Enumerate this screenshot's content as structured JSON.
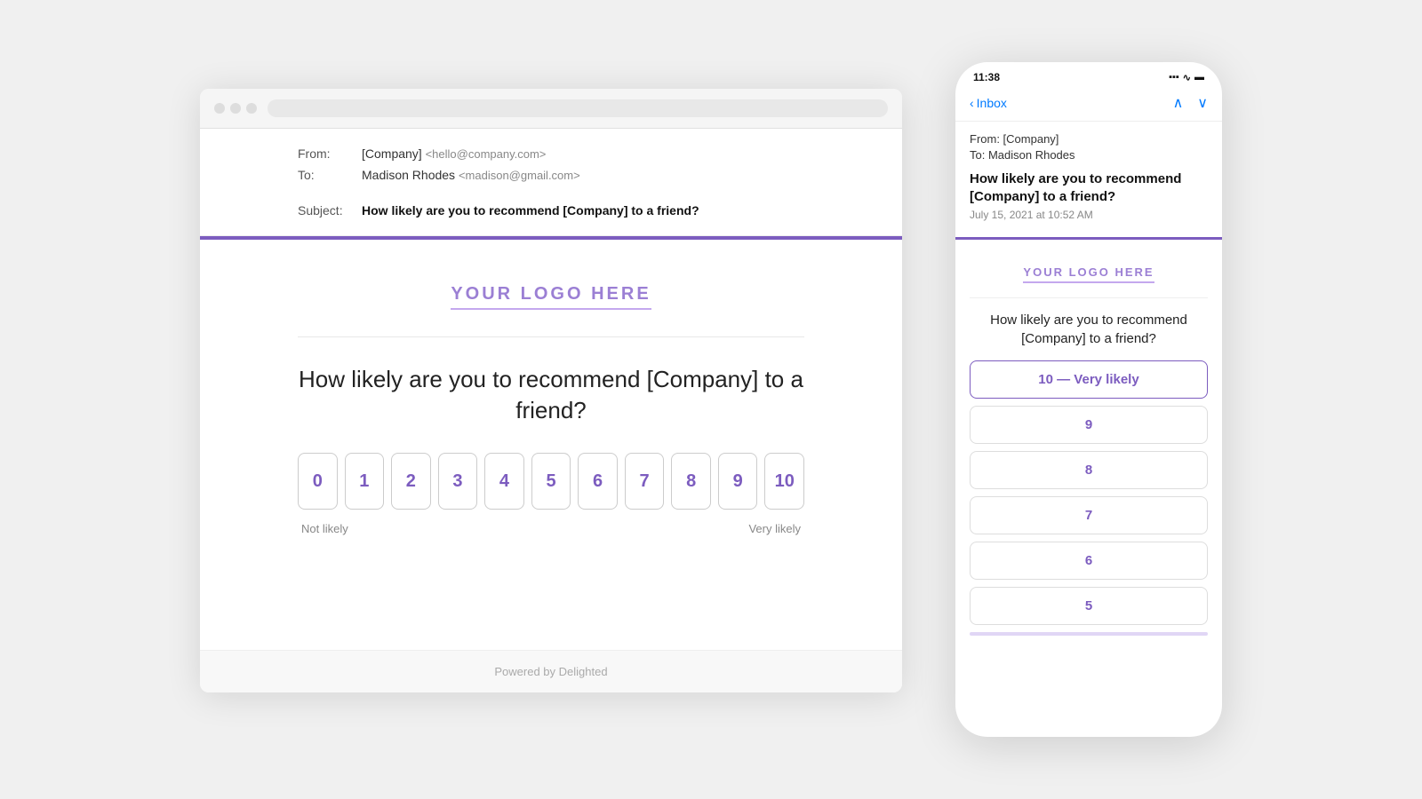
{
  "page": {
    "bg_color": "#f0f0f0"
  },
  "browser": {
    "dots": [
      "dot1",
      "dot2",
      "dot3"
    ],
    "email": {
      "from_label": "From:",
      "from_value": "[Company]",
      "from_email": "<hello@company.com>",
      "to_label": "To:",
      "to_value": "Madison Rhodes",
      "to_email": "<madison@gmail.com>",
      "subject_label": "Subject:",
      "subject_value": "How likely are you to recommend [Company] to a friend?"
    },
    "logo_text": "YOUR LOGO HERE",
    "survey_question": "How likely are you to recommend [Company] to a friend?",
    "nps_buttons": [
      "0",
      "1",
      "2",
      "3",
      "4",
      "5",
      "6",
      "7",
      "8",
      "9",
      "10"
    ],
    "label_left": "Not likely",
    "label_right": "Very likely",
    "footer_text": "Powered by Delighted"
  },
  "phone": {
    "time": "11:38",
    "back_label": "Inbox",
    "nav_up": "▲",
    "nav_down": "▼",
    "from_text": "From: [Company]",
    "to_text": "To: Madison Rhodes",
    "subject_text": "How likely are you to recommend [Company] to a friend?",
    "date_text": "July 15, 2021 at 10:52 AM",
    "logo_text": "YOUR LOGO HERE",
    "question_text": "How likely are you to recommend [Company] to a friend?",
    "nps_items": [
      {
        "label": "10 — Very likely",
        "highlighted": true
      },
      {
        "label": "9",
        "highlighted": false
      },
      {
        "label": "8",
        "highlighted": false
      },
      {
        "label": "7",
        "highlighted": false
      },
      {
        "label": "6",
        "highlighted": false
      },
      {
        "label": "5",
        "highlighted": false
      }
    ]
  }
}
